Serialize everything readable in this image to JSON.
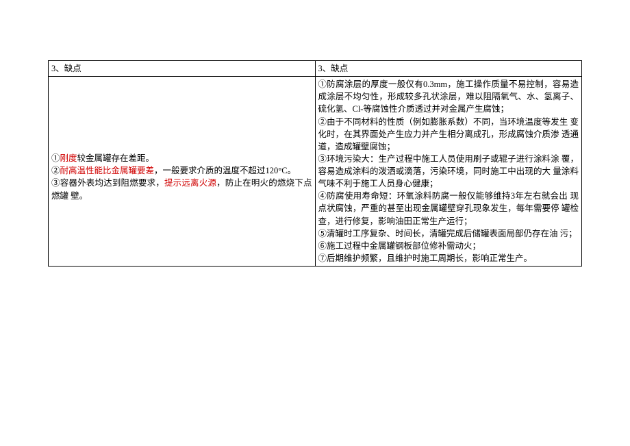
{
  "table": {
    "header_left": "3、缺点",
    "header_right": "3、缺点",
    "left": {
      "line1_prefix": "①",
      "line1_red": "刚度",
      "line1_rest": "较金属罐存在差距。",
      "line2_prefix": "②",
      "line2_red": "耐高温性能比金属罐要差",
      "line2_rest": "，一般要求介质的温度不超过120°C。",
      "line3_prefix": "③容器外表均达到阻燃要求，",
      "line3_red": "提示远离火源",
      "line3_rest": "，防止在明火的燃烧下点燃罐 壁。"
    },
    "right": {
      "p1": "①防腐涂层的厚度一般仅有0.3mm，施工操作质量不易控制，容易造 成涂层不均匀性，形成较多孔状涂层，难以阻隔氧气、水、氢离子、硫化氢、Cl-等腐蚀性介质透过并对金属产生腐蚀；",
      "p2": "②由于不同材料的性质（例如膨胀系数）不同，当环境温度等发生 变化时，在其界面处产生应力并产生相分离成孔，形成腐蚀介质渗 透通道，造成罐壁腐蚀；",
      "p3": "③环境污染大：生产过程中施工人员使用刷子或辊子进行涂料涂 覆，容易造成涂料的泼洒或滴落，污染环境，同时施工中出现的大 量涂料气味不利于施工人员身心健康；",
      "p4": "④防腐使用寿命短：环氧涂料防腐一般仅能够维持3年左右就会出 现点状腐蚀，严重的甚至出现金属罐壁穿孔现象发生，每年需要停 罐检查，进行修复，影响油田正常生产运行；",
      "p5": "⑤清罐时工序复杂、时间长，清罐完成后储罐表面局部仍存在油 污；",
      "p6": "⑥施工过程中金属罐钢板部位修补需动火；",
      "p7": "⑦后期维护频繁，且维护时施工周期长，影响正常生产。"
    }
  }
}
